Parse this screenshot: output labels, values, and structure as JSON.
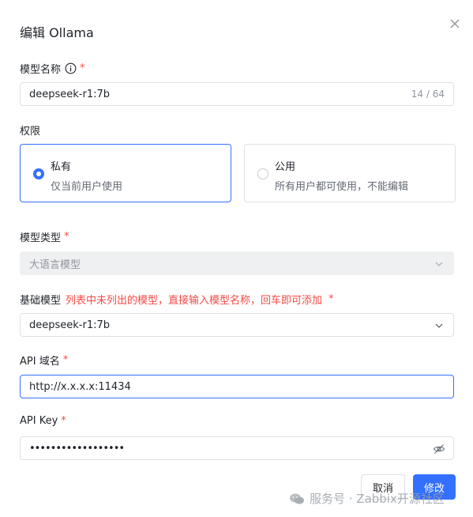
{
  "dialog": {
    "title": "编辑 Ollama"
  },
  "model_name": {
    "label": "模型名称",
    "required_mark": "*",
    "value": "deepseek-r1:7b",
    "counter": "14 / 64"
  },
  "permission": {
    "label": "权限",
    "options": [
      {
        "title": "私有",
        "desc": "仅当前用户使用",
        "selected": true
      },
      {
        "title": "公用",
        "desc": "所有用户都可使用，不能编辑",
        "selected": false
      }
    ]
  },
  "model_type": {
    "label": "模型类型",
    "required_mark": "*",
    "value": "大语言模型"
  },
  "base_model": {
    "label": "基础模型",
    "hint": "列表中未列出的模型，直接输入模型名称，回车即可添加",
    "required_mark": "*",
    "value": "deepseek-r1:7b"
  },
  "api_domain": {
    "label": "API 域名",
    "required_mark": "*",
    "value": "http://x.x.x.x:11434"
  },
  "api_key": {
    "label": "API Key",
    "required_mark": "*",
    "value": "••••••••••••••••••"
  },
  "buttons": {
    "cancel": "取消",
    "submit": "修改"
  },
  "watermark": {
    "text": "服务号 · Zabbix开源社区"
  },
  "colors": {
    "primary": "#3370ff",
    "required": "#f54a45",
    "border": "#dee0e3",
    "disabled_bg": "#eff0f1"
  }
}
